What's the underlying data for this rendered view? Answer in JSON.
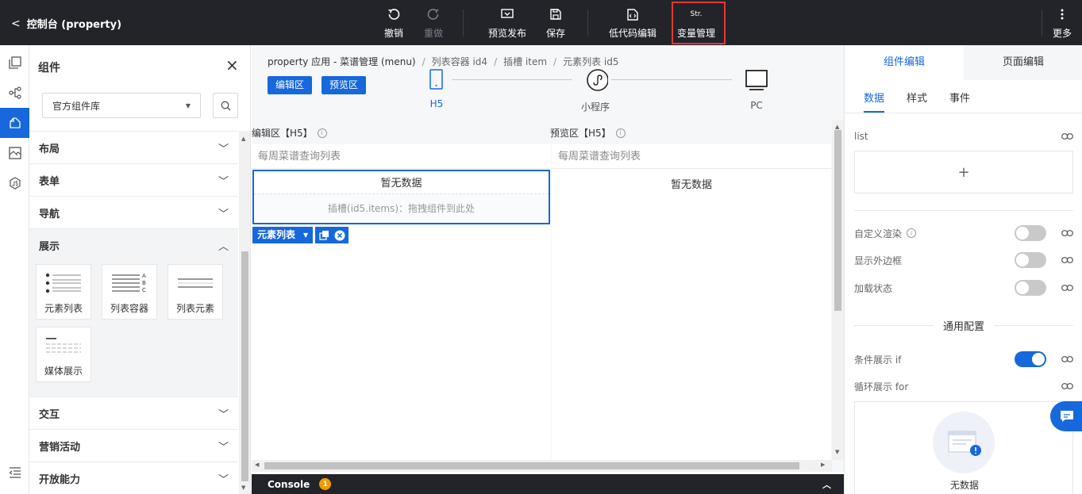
{
  "app": {
    "back_label": "控制台 (property)"
  },
  "toolbar": {
    "undo": "撤销",
    "redo": "重做",
    "preview_publish": "预览发布",
    "save": "保存",
    "lowcode_edit": "低代码编辑",
    "var_icon_text": "Str.",
    "var_manage": "变量管理",
    "more": "更多"
  },
  "components_panel": {
    "title": "组件",
    "library_select": "官方组件库",
    "categories_top": [
      "布局",
      "表单",
      "导航"
    ],
    "open_category": "展示",
    "items": [
      "元素列表",
      "列表容器",
      "列表元素",
      "媒体展示"
    ],
    "card_icon_letters": [
      "A",
      "B",
      "C"
    ],
    "categories_bottom": [
      "交互",
      "营销活动",
      "开放能力"
    ]
  },
  "canvas": {
    "breadcrumb": [
      "property 应用 - 菜谱管理 (menu)",
      "列表容器 id4",
      "插槽 item",
      "元素列表 id5"
    ],
    "edit_tab": "编辑区",
    "preview_tab": "预览区",
    "devices": [
      "H5",
      "小程序",
      "PC"
    ],
    "active_device": "H5",
    "edit_header": "编辑区【H5】",
    "preview_header": "预览区【H5】",
    "list_title": "每周菜谱查询列表",
    "no_data": "暂无数据",
    "slot_hint": "插槽(id5.items)：拖拽组件到此处",
    "selected_tag": "元素列表",
    "info_glyph": "i"
  },
  "console": {
    "label": "Console",
    "count": "1"
  },
  "props_panel": {
    "tabs": [
      "组件编辑",
      "页面编辑"
    ],
    "subtabs": [
      "数据",
      "样式",
      "事件"
    ],
    "list_label": "list",
    "add_symbol": "+",
    "custom_render": "自定义渲染",
    "show_border": "显示外边框",
    "loading_state": "加载状态",
    "general_config": "通用配置",
    "if_label": "条件展示 if",
    "for_label": "循环展示 for",
    "empty_text": "无数据",
    "toggles": {
      "custom_render": false,
      "show_border": false,
      "loading_state": false,
      "if": true
    }
  },
  "colors": {
    "accent": "#1668dc",
    "topbar": "#22242a",
    "highlight": "#e53935",
    "badge": "#f59a00"
  }
}
